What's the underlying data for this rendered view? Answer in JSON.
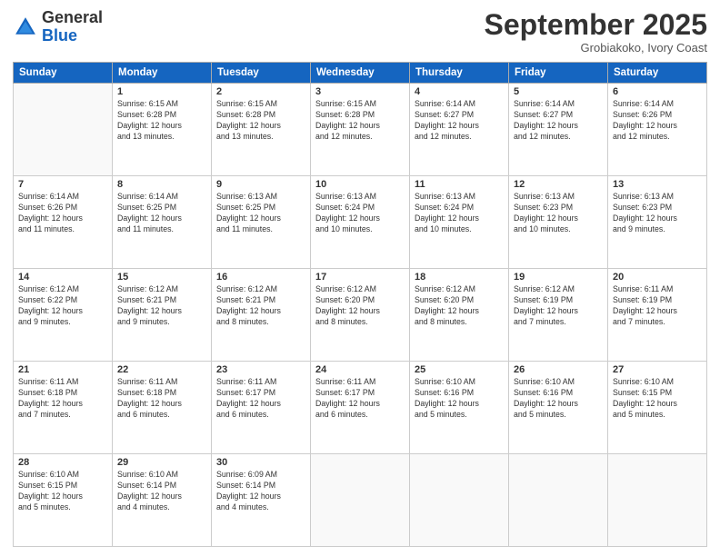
{
  "header": {
    "logo": {
      "line1": "General",
      "line2": "Blue"
    },
    "month": "September 2025",
    "location": "Grobiakoko, Ivory Coast"
  },
  "days_of_week": [
    "Sunday",
    "Monday",
    "Tuesday",
    "Wednesday",
    "Thursday",
    "Friday",
    "Saturday"
  ],
  "weeks": [
    [
      {
        "day": "",
        "info": ""
      },
      {
        "day": "1",
        "info": "Sunrise: 6:15 AM\nSunset: 6:28 PM\nDaylight: 12 hours\nand 13 minutes."
      },
      {
        "day": "2",
        "info": "Sunrise: 6:15 AM\nSunset: 6:28 PM\nDaylight: 12 hours\nand 13 minutes."
      },
      {
        "day": "3",
        "info": "Sunrise: 6:15 AM\nSunset: 6:28 PM\nDaylight: 12 hours\nand 12 minutes."
      },
      {
        "day": "4",
        "info": "Sunrise: 6:14 AM\nSunset: 6:27 PM\nDaylight: 12 hours\nand 12 minutes."
      },
      {
        "day": "5",
        "info": "Sunrise: 6:14 AM\nSunset: 6:27 PM\nDaylight: 12 hours\nand 12 minutes."
      },
      {
        "day": "6",
        "info": "Sunrise: 6:14 AM\nSunset: 6:26 PM\nDaylight: 12 hours\nand 12 minutes."
      }
    ],
    [
      {
        "day": "7",
        "info": "Sunrise: 6:14 AM\nSunset: 6:26 PM\nDaylight: 12 hours\nand 11 minutes."
      },
      {
        "day": "8",
        "info": "Sunrise: 6:14 AM\nSunset: 6:25 PM\nDaylight: 12 hours\nand 11 minutes."
      },
      {
        "day": "9",
        "info": "Sunrise: 6:13 AM\nSunset: 6:25 PM\nDaylight: 12 hours\nand 11 minutes."
      },
      {
        "day": "10",
        "info": "Sunrise: 6:13 AM\nSunset: 6:24 PM\nDaylight: 12 hours\nand 10 minutes."
      },
      {
        "day": "11",
        "info": "Sunrise: 6:13 AM\nSunset: 6:24 PM\nDaylight: 12 hours\nand 10 minutes."
      },
      {
        "day": "12",
        "info": "Sunrise: 6:13 AM\nSunset: 6:23 PM\nDaylight: 12 hours\nand 10 minutes."
      },
      {
        "day": "13",
        "info": "Sunrise: 6:13 AM\nSunset: 6:23 PM\nDaylight: 12 hours\nand 9 minutes."
      }
    ],
    [
      {
        "day": "14",
        "info": "Sunrise: 6:12 AM\nSunset: 6:22 PM\nDaylight: 12 hours\nand 9 minutes."
      },
      {
        "day": "15",
        "info": "Sunrise: 6:12 AM\nSunset: 6:21 PM\nDaylight: 12 hours\nand 9 minutes."
      },
      {
        "day": "16",
        "info": "Sunrise: 6:12 AM\nSunset: 6:21 PM\nDaylight: 12 hours\nand 8 minutes."
      },
      {
        "day": "17",
        "info": "Sunrise: 6:12 AM\nSunset: 6:20 PM\nDaylight: 12 hours\nand 8 minutes."
      },
      {
        "day": "18",
        "info": "Sunrise: 6:12 AM\nSunset: 6:20 PM\nDaylight: 12 hours\nand 8 minutes."
      },
      {
        "day": "19",
        "info": "Sunrise: 6:12 AM\nSunset: 6:19 PM\nDaylight: 12 hours\nand 7 minutes."
      },
      {
        "day": "20",
        "info": "Sunrise: 6:11 AM\nSunset: 6:19 PM\nDaylight: 12 hours\nand 7 minutes."
      }
    ],
    [
      {
        "day": "21",
        "info": "Sunrise: 6:11 AM\nSunset: 6:18 PM\nDaylight: 12 hours\nand 7 minutes."
      },
      {
        "day": "22",
        "info": "Sunrise: 6:11 AM\nSunset: 6:18 PM\nDaylight: 12 hours\nand 6 minutes."
      },
      {
        "day": "23",
        "info": "Sunrise: 6:11 AM\nSunset: 6:17 PM\nDaylight: 12 hours\nand 6 minutes."
      },
      {
        "day": "24",
        "info": "Sunrise: 6:11 AM\nSunset: 6:17 PM\nDaylight: 12 hours\nand 6 minutes."
      },
      {
        "day": "25",
        "info": "Sunrise: 6:10 AM\nSunset: 6:16 PM\nDaylight: 12 hours\nand 5 minutes."
      },
      {
        "day": "26",
        "info": "Sunrise: 6:10 AM\nSunset: 6:16 PM\nDaylight: 12 hours\nand 5 minutes."
      },
      {
        "day": "27",
        "info": "Sunrise: 6:10 AM\nSunset: 6:15 PM\nDaylight: 12 hours\nand 5 minutes."
      }
    ],
    [
      {
        "day": "28",
        "info": "Sunrise: 6:10 AM\nSunset: 6:15 PM\nDaylight: 12 hours\nand 5 minutes."
      },
      {
        "day": "29",
        "info": "Sunrise: 6:10 AM\nSunset: 6:14 PM\nDaylight: 12 hours\nand 4 minutes."
      },
      {
        "day": "30",
        "info": "Sunrise: 6:09 AM\nSunset: 6:14 PM\nDaylight: 12 hours\nand 4 minutes."
      },
      {
        "day": "",
        "info": ""
      },
      {
        "day": "",
        "info": ""
      },
      {
        "day": "",
        "info": ""
      },
      {
        "day": "",
        "info": ""
      }
    ]
  ]
}
